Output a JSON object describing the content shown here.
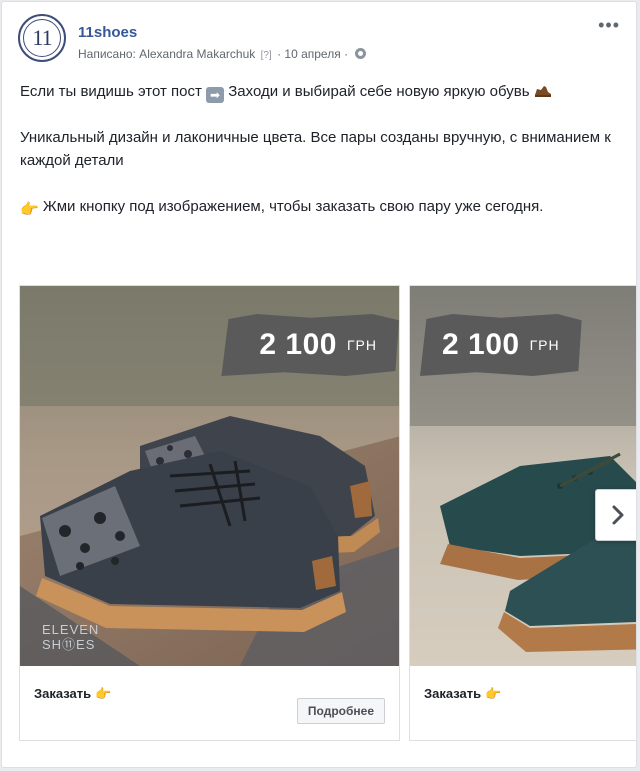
{
  "page": {
    "name": "11shoes",
    "avatar_text": "11"
  },
  "meta": {
    "written_by": "Написано: Alexandra Makarchuk",
    "help_mark": "[?]",
    "separator": "·",
    "date": "10 апреля"
  },
  "post": {
    "line1_before": "Если ты видишь этот пост",
    "line1_after": "Заходи и выбирай себе новую яркую обувь",
    "line2": "Уникальный дизайн и лаконичные цвета. Все пары созданы вручную, с вниманием к каждой детали",
    "line3": "Жми кнопку под изображением, чтобы заказать свою пару уже сегодня."
  },
  "cards": [
    {
      "price": "2 100",
      "currency": "ГРН",
      "watermark_line1": "ELEVEN",
      "watermark_line2": "SH⑪ES",
      "cta": "Заказать",
      "button": "Подробнее",
      "shoe_color": "#3a4049"
    },
    {
      "price": "2 100",
      "currency": "ГРН",
      "cta": "Заказать",
      "shoe_color": "#274a4d"
    }
  ],
  "icons": {
    "more": "more-dots-icon",
    "globe": "globe-icon",
    "arrow_right": "arrow-right-emoji-icon",
    "shoe": "shoe-emoji-icon",
    "pointing_hand": "pointing-hand-emoji-icon",
    "next": "chevron-right-icon"
  },
  "colors": {
    "link": "#365899",
    "meta": "#606770",
    "gum_sole": "#b17a45"
  }
}
